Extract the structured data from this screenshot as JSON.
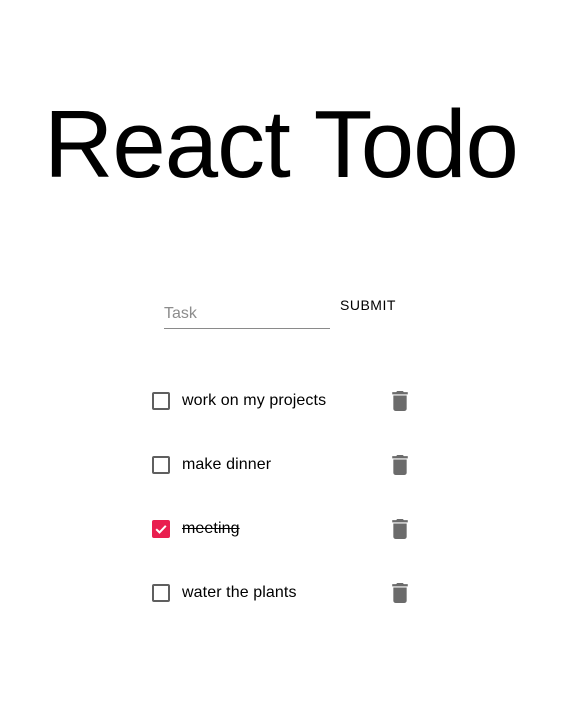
{
  "header": {
    "title": "React Todo"
  },
  "form": {
    "input_placeholder": "Task",
    "input_value": "",
    "submit_label": "SUBMIT"
  },
  "todos": [
    {
      "text": "work on my projects",
      "completed": false,
      "delete_icon": "trash-icon"
    },
    {
      "text": "make dinner",
      "completed": false,
      "delete_icon": "trash-icon"
    },
    {
      "text": "meeting",
      "completed": true,
      "delete_icon": "trash-icon"
    },
    {
      "text": "water the plants",
      "completed": false,
      "delete_icon": "trash-icon"
    }
  ],
  "colors": {
    "accent": "#e91e4f",
    "checkbox_border": "#5f5f5f",
    "icon": "#6b6b6b",
    "underline": "#8a8a8a"
  }
}
